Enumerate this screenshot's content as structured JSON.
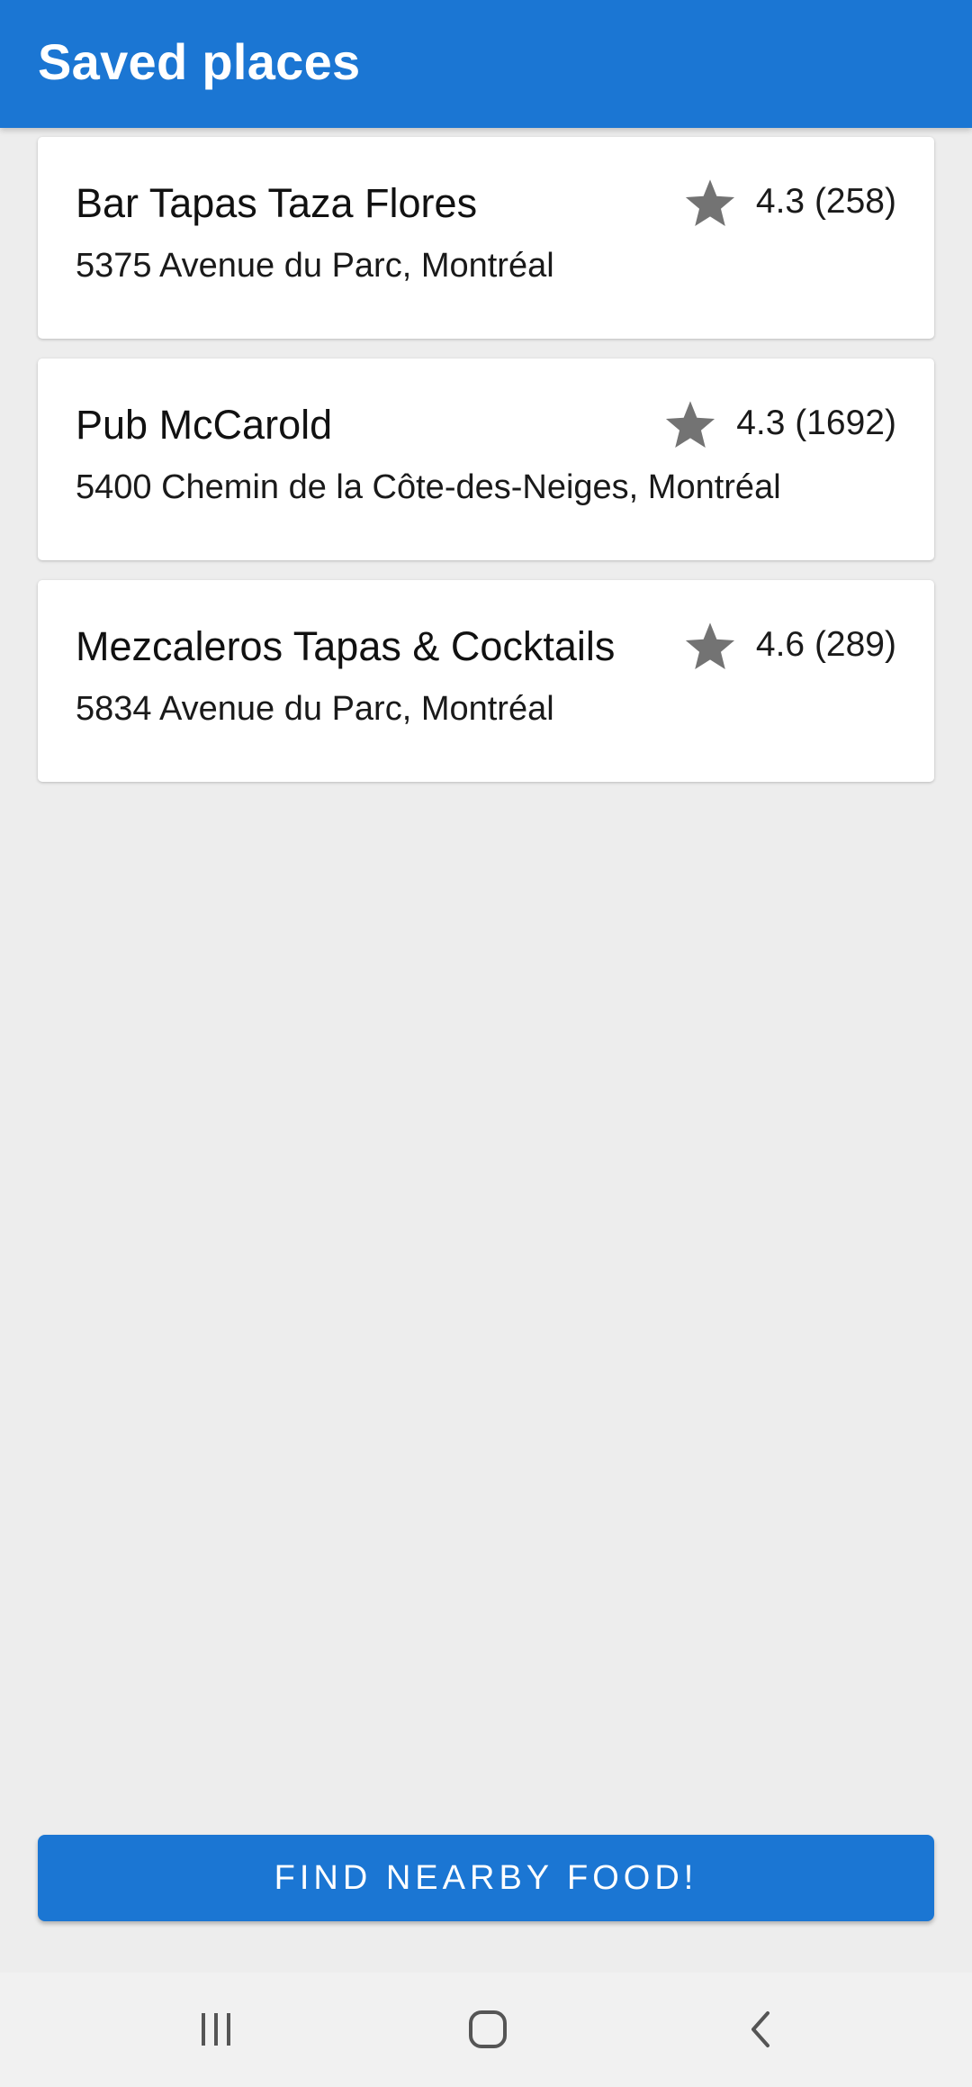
{
  "app_bar": {
    "title": "Saved places"
  },
  "places": [
    {
      "name": "Bar Tapas Taza Flores",
      "address": "5375 Avenue du Parc, Montréal",
      "rating": "4.3 (258)"
    },
    {
      "name": "Pub McCarold",
      "address": "5400 Chemin de la Côte-des-Neiges, Montréal",
      "rating": "4.3 (1692)"
    },
    {
      "name": "Mezcaleros Tapas & Cocktails",
      "address": "5834 Avenue du Parc, Montréal",
      "rating": "4.6 (289)"
    }
  ],
  "find_button": {
    "label": "FIND NEARBY FOOD!"
  },
  "icons": {
    "star": "star-icon",
    "recents": "recent-apps-icon",
    "home": "home-icon",
    "back": "back-icon"
  },
  "colors": {
    "primary": "#1b76d3",
    "background": "#ededed",
    "card": "#ffffff",
    "star": "#737373",
    "nav_bar": "#f1f1f1"
  }
}
